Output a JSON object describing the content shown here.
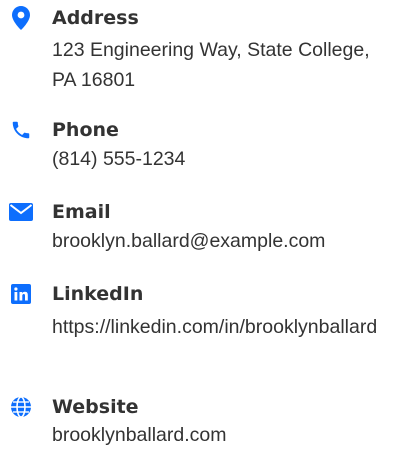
{
  "accent_color": "#0d6efd",
  "contact": {
    "items": [
      {
        "icon": "map-marker-icon",
        "label": "Address",
        "value": "123 Engineering Way, State College, PA 16801"
      },
      {
        "icon": "phone-icon",
        "label": "Phone",
        "value": "(814) 555-1234"
      },
      {
        "icon": "envelope-icon",
        "label": "Email",
        "value": "brooklyn.ballard@example.com"
      },
      {
        "icon": "linkedin-icon",
        "label": "LinkedIn",
        "value": "https://linkedin.com/in/brooklynballard"
      },
      {
        "icon": "globe-icon",
        "label": "Website",
        "value": "brooklynballard.com"
      }
    ]
  }
}
